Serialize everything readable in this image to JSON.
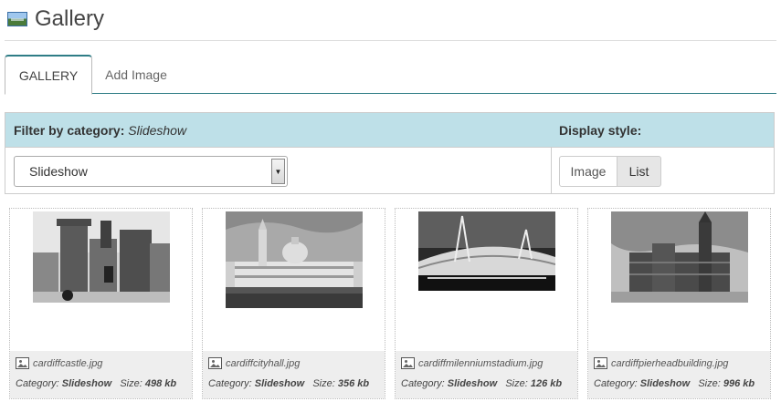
{
  "header": {
    "title": "Gallery",
    "icon": "gallery-image-icon"
  },
  "tabs": [
    {
      "label": "GALLERY",
      "active": true
    },
    {
      "label": "Add Image",
      "active": false
    }
  ],
  "filter": {
    "label": "Filter by category:",
    "current": "Slideshow",
    "select_value": "Slideshow",
    "display_label": "Display style:",
    "display_options": [
      "Image",
      "List"
    ],
    "display_selected": "List"
  },
  "meta_labels": {
    "category": "Category:",
    "size": "Size:"
  },
  "images": [
    {
      "filename": "cardiffcastle.jpg",
      "category": "Slideshow",
      "size": "498 kb"
    },
    {
      "filename": "cardiffcityhall.jpg",
      "category": "Slideshow",
      "size": "356 kb"
    },
    {
      "filename": "cardiffmilenniumstadium.jpg",
      "category": "Slideshow",
      "size": "126 kb"
    },
    {
      "filename": "cardiffpierheadbuilding.jpg",
      "category": "Slideshow",
      "size": "996 kb"
    }
  ],
  "colors": {
    "accent": "#2f7d86",
    "filter_bar": "#bee0e8"
  }
}
